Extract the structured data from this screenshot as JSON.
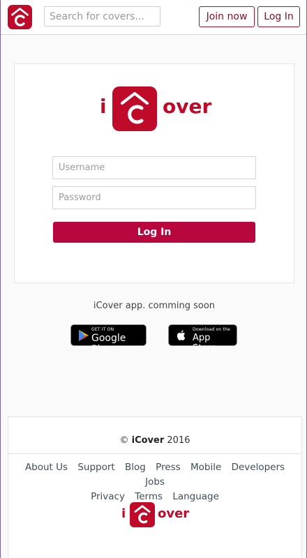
{
  "brand": {
    "prefix": "i",
    "logo_letter": "C",
    "suffix": "over",
    "color": "#bf0a2a"
  },
  "header": {
    "logo_icon": "house-c-logo-icon",
    "search_placeholder": "Search for covers...",
    "join_label": "Join now",
    "login_label": "Log In"
  },
  "login": {
    "username_placeholder": "Username",
    "password_placeholder": "Password",
    "submit_label": "Log In",
    "accent": "#b8063f"
  },
  "app": {
    "coming_soon": "iCover app. comming soon",
    "google": {
      "small": "GET IT ON",
      "big": "Google Play",
      "icon": "play-triangle-icon"
    },
    "apple": {
      "small": "Download on the",
      "big": "App Store",
      "icon": "apple-icon"
    }
  },
  "footer": {
    "copyright_symbol": "©",
    "copyright_name": "iCover",
    "copyright_year": "2016",
    "links": [
      "About Us",
      "Support",
      "Blog",
      "Press",
      "Mobile",
      "Developers",
      "Jobs",
      "Privacy",
      "Terms",
      "Language"
    ]
  }
}
